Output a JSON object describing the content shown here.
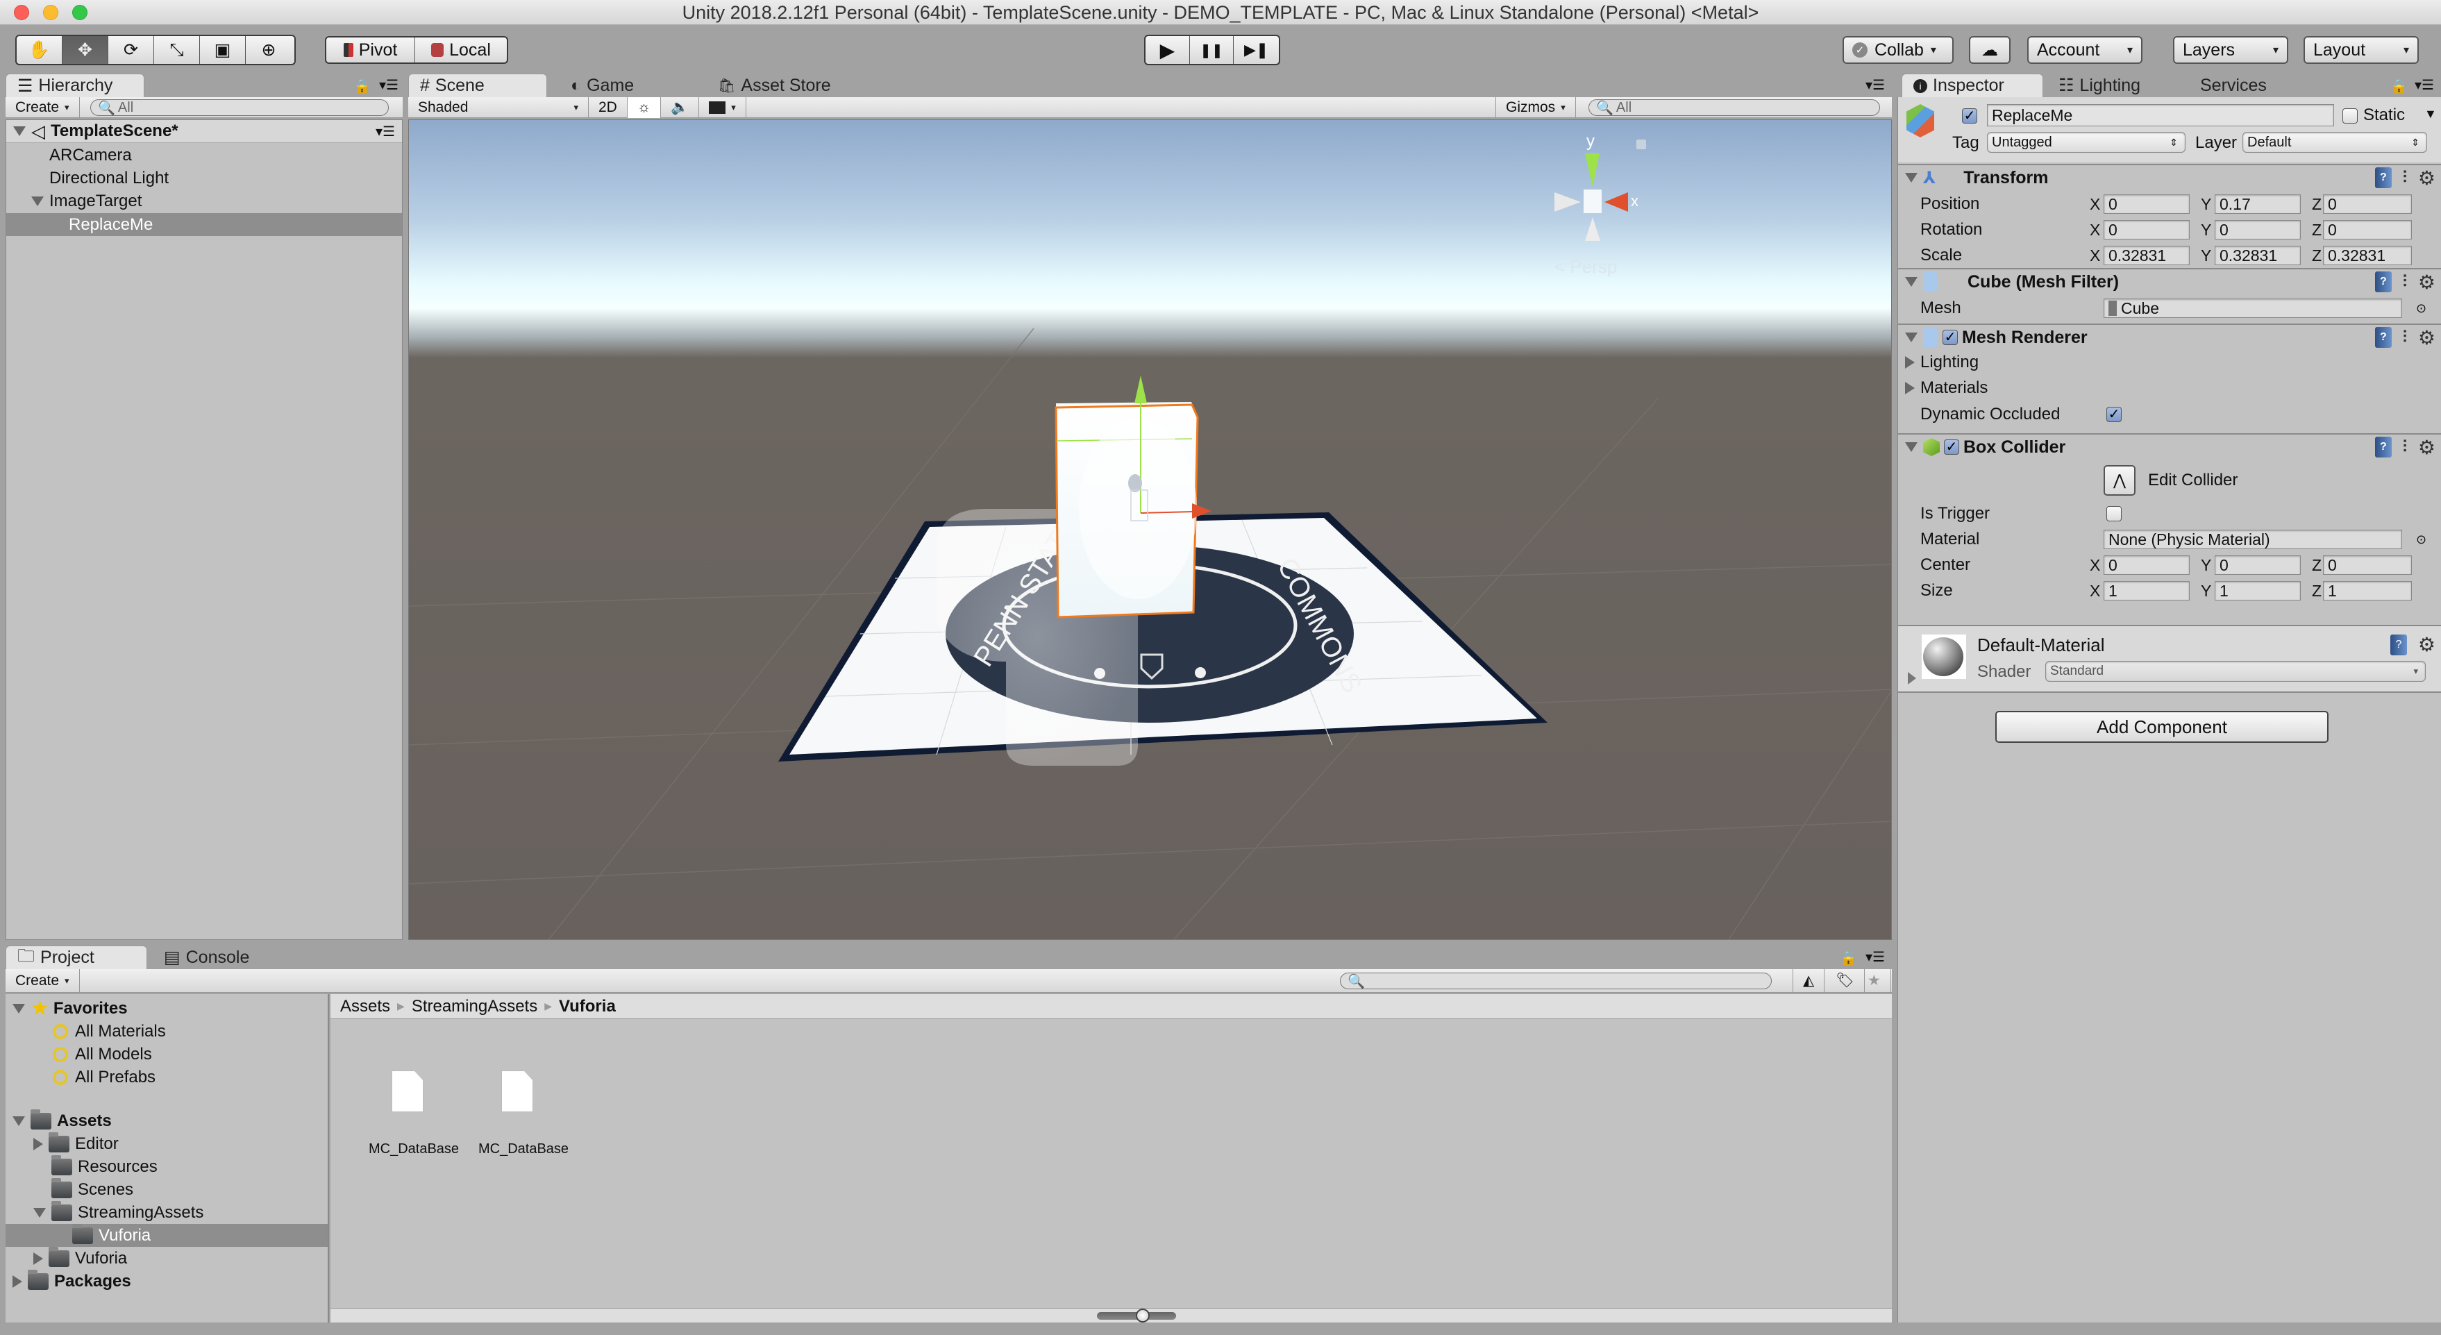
{
  "window": {
    "title": "Unity 2018.2.12f1 Personal (64bit) - TemplateScene.unity - DEMO_TEMPLATE - PC, Mac & Linux Standalone (Personal) <Metal>"
  },
  "toolbar": {
    "tools": [
      {
        "name": "hand-tool",
        "glyph": "✋",
        "active": false
      },
      {
        "name": "move-tool",
        "glyph": "✥",
        "active": true
      },
      {
        "name": "rotate-tool",
        "glyph": "⟳",
        "active": false
      },
      {
        "name": "scale-tool",
        "glyph": "⤡",
        "active": false
      },
      {
        "name": "rect-tool",
        "glyph": "▣",
        "active": false
      },
      {
        "name": "transform-tool",
        "glyph": "⊕",
        "active": false
      }
    ],
    "pivot_label": "Pivot",
    "local_label": "Local",
    "play_glyph": "▶",
    "pause_glyph": "❚❚",
    "step_glyph": "▶❚",
    "collab_label": "Collab",
    "account_label": "Account",
    "layers_label": "Layers",
    "layout_label": "Layout"
  },
  "hierarchy": {
    "tab_label": "Hierarchy",
    "create_label": "Create",
    "search_placeholder": "All",
    "scene_name": "TemplateScene*",
    "items": [
      {
        "label": "ARCamera",
        "depth": 1,
        "expandable": false,
        "selected": false
      },
      {
        "label": "Directional Light",
        "depth": 1,
        "expandable": false,
        "selected": false
      },
      {
        "label": "ImageTarget",
        "depth": 1,
        "expandable": true,
        "selected": false
      },
      {
        "label": "ReplaceMe",
        "depth": 2,
        "expandable": false,
        "selected": true
      }
    ]
  },
  "scene": {
    "tabs": [
      {
        "label": "Scene",
        "glyph": "#",
        "active": true
      },
      {
        "label": "Game",
        "glyph": "◐",
        "active": false
      },
      {
        "label": "Asset Store",
        "glyph": "🛍",
        "active": false
      }
    ],
    "shading_mode": "Shaded",
    "mode_2d_label": "2D",
    "gizmos_label": "Gizmos",
    "search_placeholder": "All",
    "gizmo_labels": {
      "y": "y",
      "x": "x"
    },
    "projection_label": "< Persp",
    "target_text_left": "PENN STATE",
    "target_text_right": "COMMONS",
    "colors": {
      "x_axis": "#e0502c",
      "y_axis": "#9ee24a",
      "selection_outline": "#f07a1e",
      "target_seal": "#2a3548"
    }
  },
  "inspector": {
    "tabs": [
      {
        "label": "Inspector",
        "active": true
      },
      {
        "label": "Lighting",
        "active": false
      },
      {
        "label": "Services",
        "active": false
      }
    ],
    "object": {
      "active": true,
      "name": "ReplaceMe",
      "static_label": "Static",
      "static": false,
      "tag_label": "Tag",
      "tag_value": "Untagged",
      "layer_label": "Layer",
      "layer_value": "Default"
    },
    "transform": {
      "title": "Transform",
      "rows": [
        {
          "label": "Position",
          "x": "0",
          "y": "0.17",
          "z": "0"
        },
        {
          "label": "Rotation",
          "x": "0",
          "y": "0",
          "z": "0"
        },
        {
          "label": "Scale",
          "x": "0.32831",
          "y": "0.32831",
          "z": "0.32831"
        }
      ]
    },
    "mesh_filter": {
      "title": "Cube (Mesh Filter)",
      "mesh_label": "Mesh",
      "mesh_value": "Cube"
    },
    "mesh_renderer": {
      "title": "Mesh Renderer",
      "enabled": true,
      "lighting_label": "Lighting",
      "materials_label": "Materials",
      "dynamic_occluded_label": "Dynamic Occluded",
      "dynamic_occluded": true
    },
    "box_collider": {
      "title": "Box Collider",
      "enabled": true,
      "edit_collider_label": "Edit Collider",
      "is_trigger_label": "Is Trigger",
      "is_trigger": false,
      "material_label": "Material",
      "material_value": "None (Physic Material)",
      "center": {
        "label": "Center",
        "x": "0",
        "y": "0",
        "z": "0"
      },
      "size": {
        "label": "Size",
        "x": "1",
        "y": "1",
        "z": "1"
      }
    },
    "material": {
      "name": "Default-Material",
      "shader_label": "Shader",
      "shader_value": "Standard"
    },
    "add_component_label": "Add Component",
    "axis_labels": {
      "x": "X",
      "y": "Y",
      "z": "Z"
    }
  },
  "project": {
    "tabs": [
      {
        "label": "Project",
        "active": true
      },
      {
        "label": "Console",
        "active": false
      }
    ],
    "create_label": "Create",
    "search_placeholder": "",
    "favorites": {
      "label": "Favorites",
      "items": [
        "All Materials",
        "All Models",
        "All Prefabs"
      ]
    },
    "assets_tree": [
      {
        "label": "Assets",
        "depth": 0,
        "expand": "open",
        "bold": true,
        "selected": false
      },
      {
        "label": "Editor",
        "depth": 1,
        "expand": "closed",
        "bold": false,
        "selected": false
      },
      {
        "label": "Resources",
        "depth": 1,
        "expand": "none",
        "bold": false,
        "selected": false
      },
      {
        "label": "Scenes",
        "depth": 1,
        "expand": "none",
        "bold": false,
        "selected": false
      },
      {
        "label": "StreamingAssets",
        "depth": 1,
        "expand": "open",
        "bold": false,
        "selected": false
      },
      {
        "label": "Vuforia",
        "depth": 2,
        "expand": "none",
        "bold": false,
        "selected": true
      },
      {
        "label": "Vuforia",
        "depth": 1,
        "expand": "closed",
        "bold": false,
        "selected": false
      },
      {
        "label": "Packages",
        "depth": 0,
        "expand": "closed",
        "bold": true,
        "selected": false
      }
    ],
    "breadcrumb": [
      "Assets",
      "StreamingAssets",
      "Vuforia"
    ],
    "files": [
      {
        "name": "MC_DataBase"
      },
      {
        "name": "MC_DataBase"
      }
    ],
    "icon_size_slider": 0.6
  }
}
